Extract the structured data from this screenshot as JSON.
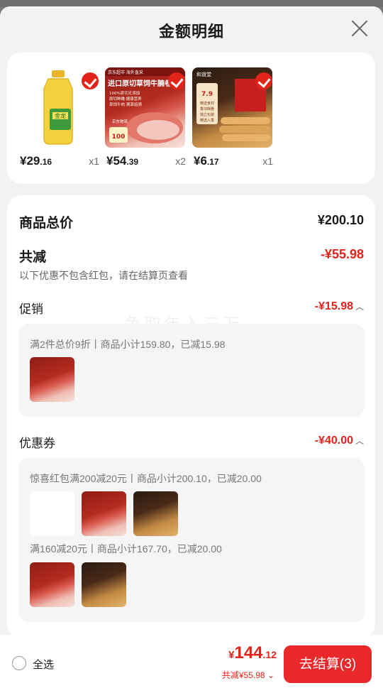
{
  "header": {
    "title": "金额明细"
  },
  "products": [
    {
      "price_main": "¥29",
      "price_dec": ".16",
      "qty": "x1"
    },
    {
      "price_main": "¥54",
      "price_dec": ".39",
      "qty": "x2"
    },
    {
      "price_main": "¥6",
      "price_dec": ".17",
      "qty": "x1"
    }
  ],
  "product_images": {
    "oil_label": "金龙",
    "beef_tag": "京东超市 海外直采",
    "beef_title": "进口原切草饲牛腩卷",
    "beef_bullets": [
      "100%原切无添加",
      "原切鲜嫩·健康营养",
      "草饲牛肉 溯源追溯"
    ],
    "beef_badge": "100",
    "beef_promo": "京东物流",
    "rolls_brand": "和道堂",
    "rolls_price": "7.9",
    "rolls_lines": [
      "精选食材",
      "香浓酥脆",
      "独立包装",
      "精选入香"
    ]
  },
  "summary": {
    "goods_total_label": "商品总价",
    "goods_total_value": "¥200.10",
    "reduce_label": "共减",
    "reduce_value": "-¥55.98",
    "note": "以下优惠不包含红包，请在结算页查看"
  },
  "promotion": {
    "label": "促销",
    "value": "-¥15.98",
    "line": "满2件总价9折丨商品小计159.80，已减15.98"
  },
  "coupon": {
    "label": "优惠券",
    "value": "-¥40.00",
    "line1": "惊喜红包满200减20元丨商品小计200.10，已减20.00",
    "line2": "满160减20元丨商品小计167.70，已减20.00"
  },
  "watermark": "争取年入三万",
  "footer": {
    "select_all": "全选",
    "total_yen": "¥",
    "total_main": "144",
    "total_dec": ".12",
    "saved": "共减¥55.98",
    "checkout": "去结算(3)"
  },
  "colors": {
    "accent": "#e2231a",
    "button": "#e8282b"
  }
}
